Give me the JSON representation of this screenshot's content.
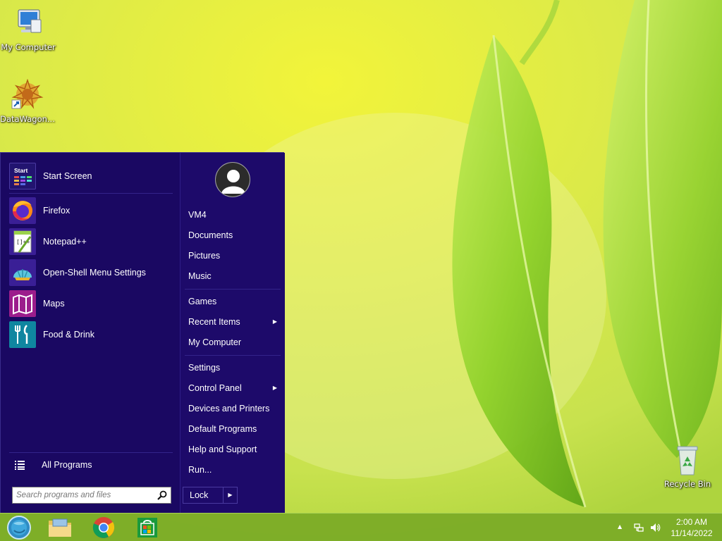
{
  "desktop": {
    "icons": [
      {
        "label": "My Computer"
      },
      {
        "label": "DataWagon..."
      },
      {
        "label": "Recycle Bin"
      }
    ]
  },
  "start_menu": {
    "programs": [
      {
        "label": "Start Screen",
        "icon": "start-screen-icon",
        "tile_text": "Start"
      },
      {
        "label": "Firefox",
        "icon": "firefox-icon"
      },
      {
        "label": "Notepad++",
        "icon": "notepadpp-icon"
      },
      {
        "label": "Open-Shell Menu Settings",
        "icon": "open-shell-icon"
      },
      {
        "label": "Maps",
        "icon": "maps-icon"
      },
      {
        "label": "Food & Drink",
        "icon": "food-drink-icon"
      }
    ],
    "all_programs": "All Programs",
    "search_placeholder": "Search programs and files",
    "search_value": "",
    "right_items": [
      {
        "label": "VM4",
        "submenu": false
      },
      {
        "label": "Documents",
        "submenu": false
      },
      {
        "label": "Pictures",
        "submenu": false
      },
      {
        "label": "Music",
        "submenu": false
      },
      {
        "label": "Games",
        "submenu": false
      },
      {
        "label": "Recent Items",
        "submenu": true
      },
      {
        "label": "My Computer",
        "submenu": false
      },
      {
        "label": "Settings",
        "submenu": false
      },
      {
        "label": "Control Panel",
        "submenu": true
      },
      {
        "label": "Devices and Printers",
        "submenu": false
      },
      {
        "label": "Default Programs",
        "submenu": false
      },
      {
        "label": "Help and Support",
        "submenu": false
      },
      {
        "label": "Run...",
        "submenu": false
      }
    ],
    "lock_label": "Lock",
    "arrow_glyph": "▶"
  },
  "taskbar": {
    "buttons": [
      "start-orb-icon",
      "file-explorer-icon",
      "chrome-icon",
      "store-icon"
    ],
    "tray": {
      "show_hidden_glyph": "▲",
      "time": "2:00 AM",
      "date": "11/14/2022"
    }
  },
  "colors": {
    "menu_bg": "#1d0a6a",
    "taskbar": "#7aaa26",
    "wallpaper_accent": "#dfec4a"
  }
}
